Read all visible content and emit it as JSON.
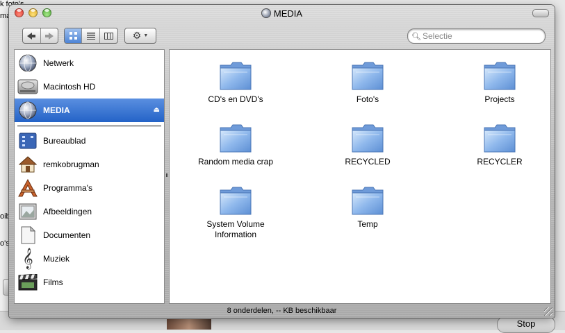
{
  "background": {
    "fragments": [
      "k foto's",
      "ma",
      "oib",
      "o's"
    ],
    "stop_label": "Stop"
  },
  "window": {
    "title": "MEDIA",
    "search": {
      "placeholder": "Selectie"
    },
    "status": "8 onderdelen, -- KB beschikbaar"
  },
  "sidebar": {
    "devices": [
      {
        "label": "Netwerk",
        "icon": "network-globe-icon"
      },
      {
        "label": "Macintosh HD",
        "icon": "hard-drive-icon"
      },
      {
        "label": "MEDIA",
        "icon": "media-drive-icon",
        "selected": true,
        "ejectable": true
      }
    ],
    "places": [
      {
        "label": "Bureaublad",
        "icon": "desktop-icon"
      },
      {
        "label": "remkobrugman",
        "icon": "home-icon"
      },
      {
        "label": "Programma's",
        "icon": "applications-icon"
      },
      {
        "label": "Afbeeldingen",
        "icon": "pictures-icon"
      },
      {
        "label": "Documenten",
        "icon": "documents-icon"
      },
      {
        "label": "Muziek",
        "icon": "music-icon"
      },
      {
        "label": "Films",
        "icon": "movies-icon"
      }
    ]
  },
  "folders": [
    {
      "label": "CD's en DVD's"
    },
    {
      "label": "Foto's"
    },
    {
      "label": "Projects"
    },
    {
      "label": "Random media crap"
    },
    {
      "label": "RECYCLED"
    },
    {
      "label": "RECYCLER"
    },
    {
      "label": "System Volume\nInformation"
    },
    {
      "label": "Temp"
    }
  ],
  "colors": {
    "selection": "#2f6fd0",
    "folder_blue": "#8fb8ec"
  }
}
